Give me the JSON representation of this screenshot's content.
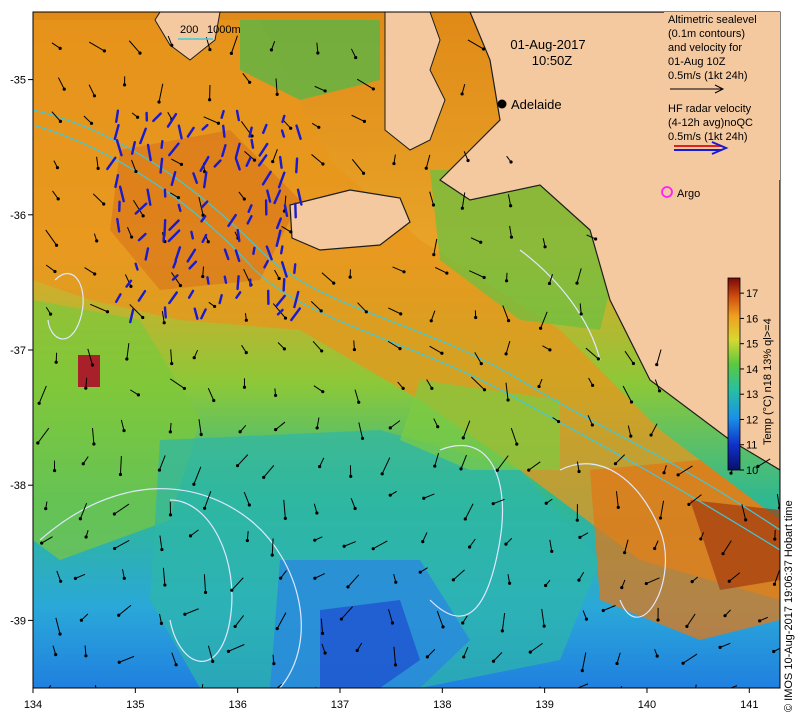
{
  "title": {
    "date": "01-Aug-2017",
    "time": "10:50Z"
  },
  "scale_bar": {
    "label_a": "200",
    "label_b": "1000m"
  },
  "legend": {
    "altimetry_lines": [
      "Altimetric sealevel",
      "(0.1m contours)",
      "and velocity for",
      "01-Aug 10Z",
      "0.5m/s (1kt 24h)"
    ],
    "radar_lines": [
      "HF radar velocity",
      "(4-12h avg)noQC",
      "0.5m/s (1kt 24h)"
    ],
    "argo_label": "Argo"
  },
  "places": {
    "city": "Adelaide"
  },
  "colorbar": {
    "label": "Temp (°C) n18 13% ql>=4",
    "ticks": [
      "17",
      "16",
      "15",
      "14",
      "13",
      "12",
      "11",
      "10"
    ],
    "min": 10,
    "max": 17.6
  },
  "axes": {
    "lon_ticks": [
      "134",
      "135",
      "136",
      "137",
      "138",
      "139",
      "140",
      "141"
    ],
    "lat_ticks": [
      "-35",
      "-36",
      "-37",
      "-38",
      "-39"
    ],
    "lon_range": [
      134,
      141.3
    ],
    "lat_range": [
      -34.5,
      -39.5
    ]
  },
  "credit": "© IMOS 10-Aug-2017 19:06:37 Hobart time",
  "colors": {
    "land": "#f5c9a0",
    "coast": "#1e1e1e",
    "warm": "#d98a20",
    "cool": "#2fb5a0",
    "cold": "#2aa0e0",
    "radar_arrow": "#1a1ad0",
    "argo": "#ff20ff",
    "contour": "#dfe8ff",
    "isobath": "#40c8d8"
  }
}
